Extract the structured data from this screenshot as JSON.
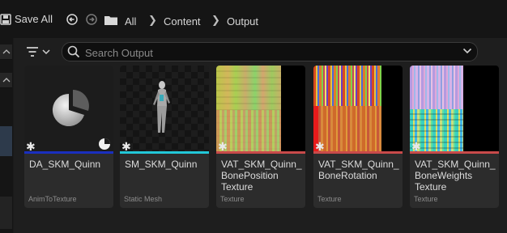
{
  "toolbar": {
    "save_all_label": "Save All",
    "breadcrumbs": [
      "All",
      "Content",
      "Output"
    ]
  },
  "search": {
    "placeholder": "Search Output"
  },
  "assets": [
    {
      "name": "DA_SKM_Quinn",
      "type": "AnimToTexture",
      "bar_color": "#1a2fbf"
    },
    {
      "name": "SM_SKM_Quinn",
      "type": "Static Mesh",
      "bar_color": "#22c7d8"
    },
    {
      "name": "VAT_SKM_Quinn_\nBonePosition\nTexture",
      "type": "Texture",
      "bar_color": "#c84a4a"
    },
    {
      "name": "VAT_SKM_Quinn_\nBoneRotation",
      "type": "Texture",
      "bar_color": "#c84a4a"
    },
    {
      "name": "VAT_SKM_Quinn_\nBoneWeights\nTexture",
      "type": "Texture",
      "bar_color": "#c84a4a"
    }
  ],
  "icons": {
    "save": "floppy-disk-icon",
    "back": "back-arrow-icon",
    "forward": "forward-arrow-icon",
    "folder": "folder-icon",
    "filter": "filter-icon",
    "search": "search-icon"
  }
}
